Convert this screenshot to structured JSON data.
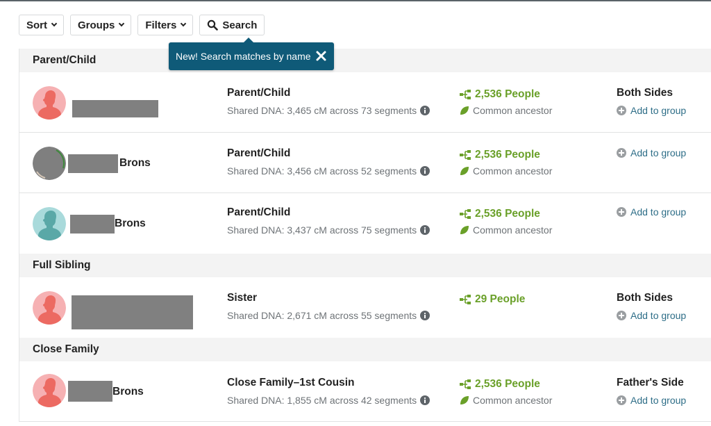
{
  "toolbar": {
    "sort_label": "Sort",
    "groups_label": "Groups",
    "filters_label": "Filters",
    "search_label": "Search"
  },
  "tooltip": {
    "text": "New! Search matches by name"
  },
  "colors": {
    "accent_green": "#6aa029",
    "tooltip_bg": "#0f5a78",
    "link_blue": "#2d6d87",
    "avatar_female_bg": "#f6b1b3",
    "avatar_female_fg": "#ec6a62",
    "avatar_male_bg": "#a9dadb",
    "avatar_male_fg": "#5aa8a7"
  },
  "groups": [
    {
      "title": "Parent/Child",
      "matches": [
        {
          "avatar": "female-silhouette",
          "name_suffix": "",
          "relationship": "Parent/Child",
          "shared_dna": "Shared DNA: 3,465 cM across 73 segments",
          "people": "2,536 People",
          "common_ancestor": "Common ancestor",
          "side": "Both Sides",
          "add_to_group": "Add to group"
        },
        {
          "avatar": "photo",
          "name_suffix": "Brons",
          "relationship": "Parent/Child",
          "shared_dna": "Shared DNA: 3,456 cM across 52 segments",
          "people": "2,536 People",
          "common_ancestor": "Common ancestor",
          "side": "",
          "add_to_group": "Add to group"
        },
        {
          "avatar": "male-silhouette",
          "name_suffix": "Brons",
          "relationship": "Parent/Child",
          "shared_dna": "Shared DNA: 3,437 cM across 75 segments",
          "people": "2,536 People",
          "common_ancestor": "Common ancestor",
          "side": "",
          "add_to_group": "Add to group"
        }
      ]
    },
    {
      "title": "Full Sibling",
      "matches": [
        {
          "avatar": "female-silhouette",
          "name_suffix": "",
          "relationship": "Sister",
          "shared_dna": "Shared DNA: 2,671 cM across 55 segments",
          "people": "29 People",
          "common_ancestor": "",
          "side": "Both Sides",
          "add_to_group": "Add to group"
        }
      ]
    },
    {
      "title": "Close Family",
      "matches": [
        {
          "avatar": "female-silhouette",
          "name_suffix": "Brons",
          "relationship": "Close Family–1st Cousin",
          "shared_dna": "Shared DNA: 1,855 cM across 42 segments",
          "people": "2,536 People",
          "common_ancestor": "Common ancestor",
          "side": "Father's Side",
          "add_to_group": "Add to group"
        }
      ]
    }
  ]
}
